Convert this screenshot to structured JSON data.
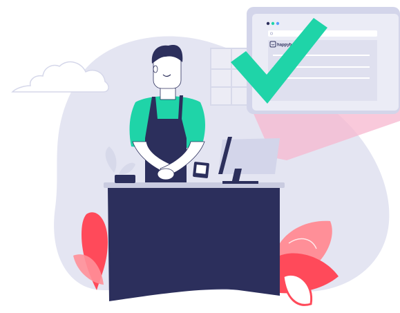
{
  "browser_window": {
    "logo_text": "happybox",
    "dot_colors": [
      "#2c2f5c",
      "#1fd4a8",
      "#5c9bff"
    ]
  },
  "colors": {
    "background_blob": "#e4e5f2",
    "counter": "#2c2f5c",
    "counter_top": "#c9cbe0",
    "shirt": "#1fd4a8",
    "apron": "#2c2f5c",
    "hair": "#2c2f5c",
    "skin": "#ffffff",
    "checkmark": "#1fd4a8",
    "projection": "#f7b7cf",
    "leaf_red": "#ff4a5a",
    "leaf_pink": "#ff8f98",
    "monitor": "#c9cbe0"
  },
  "icons": {
    "checkmark": "checkmark-icon",
    "logo": "happybox-logo-icon",
    "cloud": "cloud-icon"
  }
}
